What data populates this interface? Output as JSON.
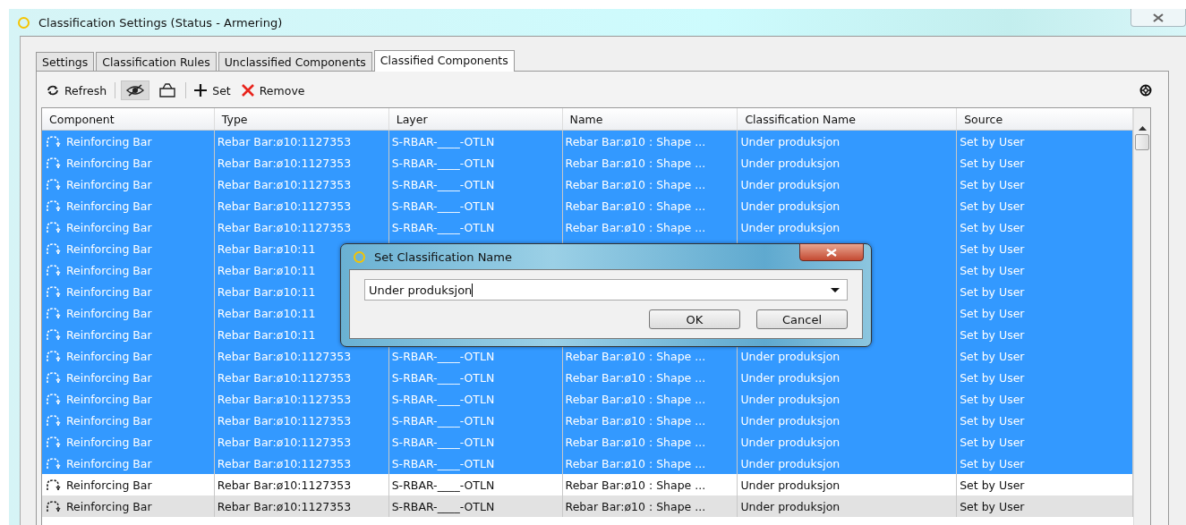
{
  "window": {
    "title": "Classification Settings (Status - Armering)"
  },
  "tabs": [
    {
      "label": "Settings",
      "selected": false
    },
    {
      "label": "Classification Rules",
      "selected": false
    },
    {
      "label": "Unclassified Components",
      "selected": false
    },
    {
      "label": "Classified Components",
      "selected": true
    }
  ],
  "toolbar": [
    {
      "kind": "refresh",
      "label": "Refresh"
    },
    {
      "kind": "separator"
    },
    {
      "kind": "hide-toggle",
      "pressed": true
    },
    {
      "kind": "shape-toggle",
      "pressed": false
    },
    {
      "kind": "separator"
    },
    {
      "kind": "set",
      "label": "Set"
    },
    {
      "kind": "remove",
      "label": "Remove"
    }
  ],
  "table": {
    "columns": [
      "Component",
      "Type",
      "Layer",
      "Name",
      "Classification Name",
      "Source"
    ],
    "rows": [
      {
        "selected": true,
        "cells": [
          "Reinforcing Bar",
          "Rebar Bar:ø10:1127353",
          "S-RBAR-____-OTLN",
          "Rebar Bar:ø10 : Shape ...",
          "Under produksjon",
          "Set by User"
        ]
      },
      {
        "selected": true,
        "cells": [
          "Reinforcing Bar",
          "Rebar Bar:ø10:1127353",
          "S-RBAR-____-OTLN",
          "Rebar Bar:ø10 : Shape ...",
          "Under produksjon",
          "Set by User"
        ]
      },
      {
        "selected": true,
        "cells": [
          "Reinforcing Bar",
          "Rebar Bar:ø10:1127353",
          "S-RBAR-____-OTLN",
          "Rebar Bar:ø10 : Shape ...",
          "Under produksjon",
          "Set by User"
        ]
      },
      {
        "selected": true,
        "cells": [
          "Reinforcing Bar",
          "Rebar Bar:ø10:1127353",
          "S-RBAR-____-OTLN",
          "Rebar Bar:ø10 : Shape ...",
          "Under produksjon",
          "Set by User"
        ]
      },
      {
        "selected": true,
        "cells": [
          "Reinforcing Bar",
          "Rebar Bar:ø10:1127353",
          "S-RBAR-____-OTLN",
          "Rebar Bar:ø10 : Shape ...",
          "Under produksjon",
          "Set by User"
        ]
      },
      {
        "selected": true,
        "cells": [
          "Reinforcing Bar",
          "Rebar Bar:ø10:11",
          null,
          null,
          null,
          "Set by User"
        ]
      },
      {
        "selected": true,
        "cells": [
          "Reinforcing Bar",
          "Rebar Bar:ø10:11",
          null,
          null,
          null,
          "Set by User"
        ]
      },
      {
        "selected": true,
        "cells": [
          "Reinforcing Bar",
          "Rebar Bar:ø10:11",
          null,
          null,
          null,
          "Set by User"
        ]
      },
      {
        "selected": true,
        "cells": [
          "Reinforcing Bar",
          "Rebar Bar:ø10:11",
          null,
          null,
          null,
          "Set by User"
        ]
      },
      {
        "selected": true,
        "cells": [
          "Reinforcing Bar",
          "Rebar Bar:ø10:11",
          null,
          null,
          null,
          "Set by User"
        ]
      },
      {
        "selected": true,
        "cells": [
          "Reinforcing Bar",
          "Rebar Bar:ø10:1127353",
          "S-RBAR-____-OTLN",
          "Rebar Bar:ø10 : Shape ...",
          "Under produksjon",
          "Set by User"
        ]
      },
      {
        "selected": true,
        "cells": [
          "Reinforcing Bar",
          "Rebar Bar:ø10:1127353",
          "S-RBAR-____-OTLN",
          "Rebar Bar:ø10 : Shape ...",
          "Under produksjon",
          "Set by User"
        ]
      },
      {
        "selected": true,
        "cells": [
          "Reinforcing Bar",
          "Rebar Bar:ø10:1127353",
          "S-RBAR-____-OTLN",
          "Rebar Bar:ø10 : Shape ...",
          "Under produksjon",
          "Set by User"
        ]
      },
      {
        "selected": true,
        "cells": [
          "Reinforcing Bar",
          "Rebar Bar:ø10:1127353",
          "S-RBAR-____-OTLN",
          "Rebar Bar:ø10 : Shape ...",
          "Under produksjon",
          "Set by User"
        ]
      },
      {
        "selected": true,
        "cells": [
          "Reinforcing Bar",
          "Rebar Bar:ø10:1127353",
          "S-RBAR-____-OTLN",
          "Rebar Bar:ø10 : Shape ...",
          "Under produksjon",
          "Set by User"
        ]
      },
      {
        "selected": true,
        "cells": [
          "Reinforcing Bar",
          "Rebar Bar:ø10:1127353",
          "S-RBAR-____-OTLN",
          "Rebar Bar:ø10 : Shape ...",
          "Under produksjon",
          "Set by User"
        ]
      },
      {
        "selected": false,
        "cells": [
          "Reinforcing Bar",
          "Rebar Bar:ø10:1127353",
          "S-RBAR-____-OTLN",
          "Rebar Bar:ø10 : Shape ...",
          "Under produksjon",
          "Set by User"
        ]
      },
      {
        "selected": false,
        "cells": [
          "Reinforcing Bar",
          "Rebar Bar:ø10:1127353",
          "S-RBAR-____-OTLN",
          "Rebar Bar:ø10 : Shape ...",
          "Under produksjon",
          "Set by User"
        ]
      }
    ]
  },
  "dialog": {
    "title": "Set Classification Name",
    "value": "Under produksjon",
    "buttons": [
      "OK",
      "Cancel"
    ]
  }
}
